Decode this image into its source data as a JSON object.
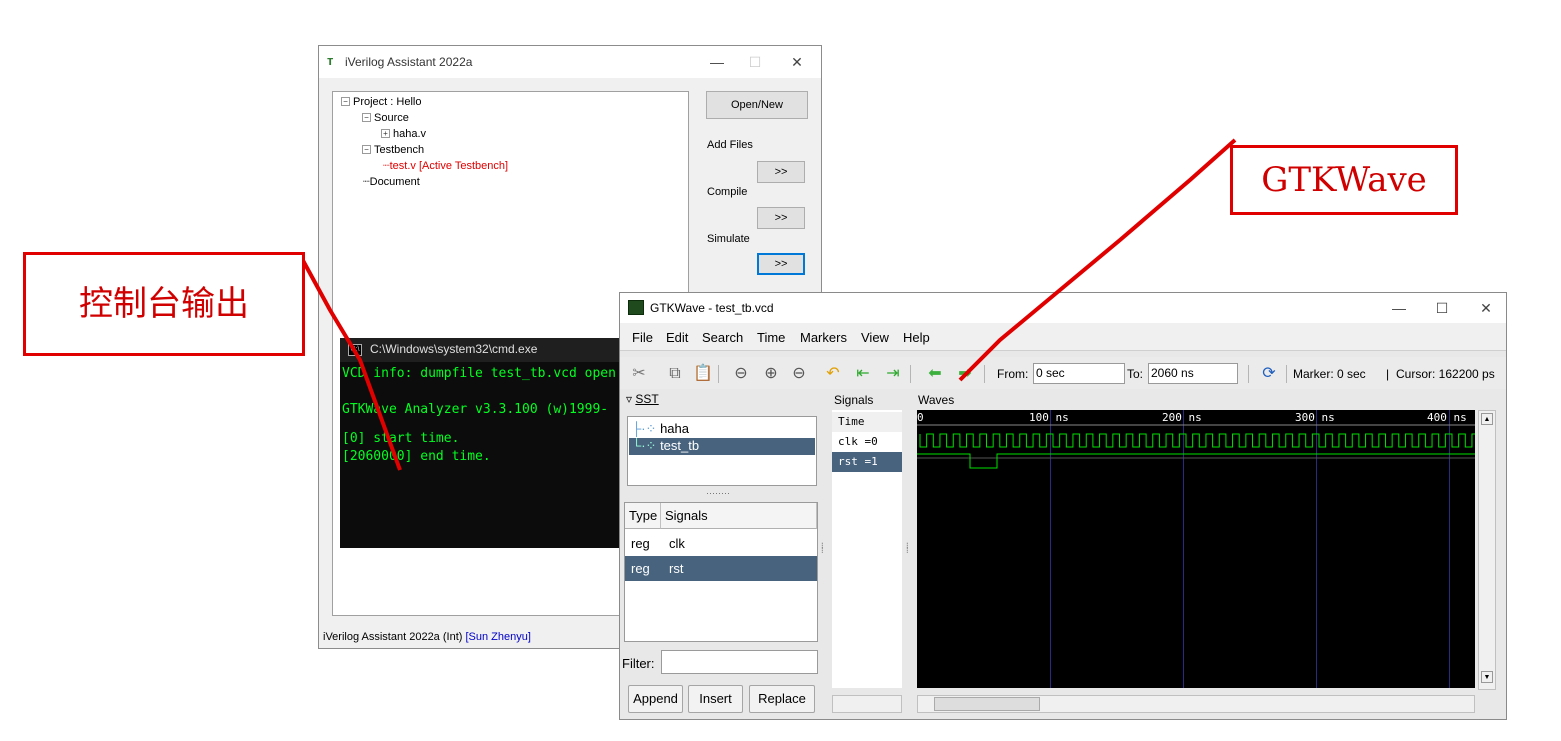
{
  "iverilog": {
    "title": "iVerilog Assistant 2022a",
    "tree": [
      {
        "label": "Project : Hello",
        "toggle": "−"
      },
      {
        "label": "Source",
        "toggle": "−"
      },
      {
        "label": "haha.v",
        "toggle": "+"
      },
      {
        "label": "Testbench",
        "toggle": "−"
      },
      {
        "label": "test.v [Active Testbench]"
      },
      {
        "label": "Document"
      }
    ],
    "buttons": {
      "open_new": "Open/New",
      "add": ">>",
      "compile": ">>",
      "simulate": ">>"
    },
    "labels": {
      "add_files": "Add Files",
      "compile": "Compile",
      "simulate": "Simulate"
    },
    "status": {
      "app": "iVerilog Assistant 2022a  (Int)",
      "user": "[Sun Zhenyu]"
    }
  },
  "cmd": {
    "title": "C:\\Windows\\system32\\cmd.exe",
    "lines": [
      "VCD info: dumpfile test_tb.vcd open",
      "",
      "GTKWave Analyzer v3.3.100 (w)1999-",
      "",
      "[0] start time.",
      "[2060000] end time."
    ]
  },
  "gtkwave": {
    "title": "GTKWave - test_tb.vcd",
    "menu": [
      "File",
      "Edit",
      "Search",
      "Time",
      "Markers",
      "View",
      "Help"
    ],
    "toolbar": {
      "from_label": "From:",
      "from_value": "0 sec",
      "to_label": "To:",
      "to_value": "2060 ns",
      "marker": "Marker: 0 sec",
      "separator": "|",
      "cursor": "Cursor: 162200 ps"
    },
    "sst": {
      "label": "SST",
      "items": [
        "haha",
        "test_tb"
      ]
    },
    "signals_table": {
      "headers": [
        "Type",
        "Signals"
      ],
      "rows": [
        {
          "type": "reg",
          "name": "clk"
        },
        {
          "type": "reg",
          "name": "rst"
        }
      ]
    },
    "filter_label": "Filter:",
    "buttons": [
      "Append",
      "Insert",
      "Replace"
    ],
    "signals_panel": {
      "label": "Signals",
      "rows": [
        "Time",
        "clk =0",
        "rst =1"
      ]
    },
    "waves": {
      "label": "Waves",
      "ruler": [
        "0",
        "100 ns",
        "200 ns",
        "300 ns",
        "400 ns"
      ],
      "wave_color": "#00e000"
    }
  },
  "annotations": {
    "console": "控制台输出",
    "gtkwave": "GTKWave",
    "color": "#e00000"
  }
}
